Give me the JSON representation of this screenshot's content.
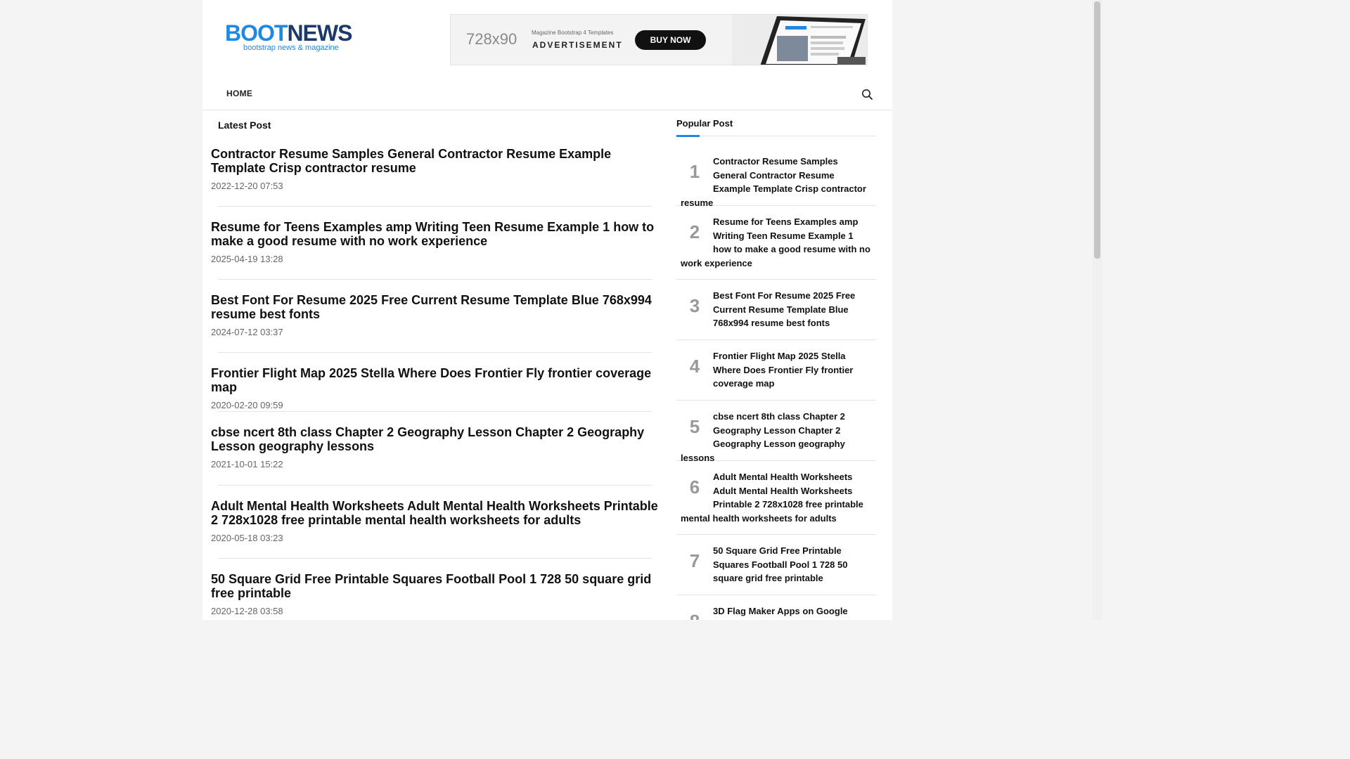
{
  "logo": {
    "word_a": "BOOT",
    "word_b": "NEWS",
    "tagline": "bootstrap news & magazine"
  },
  "ad": {
    "size_text": "728x90",
    "line1": "Magazine Bootstrap 4 Templates",
    "line2": "ADVERTISEMENT",
    "button": "BUY NOW"
  },
  "nav": {
    "home": "HOME",
    "search_icon": "search-icon"
  },
  "latest": {
    "title": "Latest Post",
    "posts": [
      {
        "title": "Contractor Resume Samples General Contractor Resume Example Template Crisp contractor resume",
        "date": "2022-12-20 07:53"
      },
      {
        "title": "Resume for Teens Examples amp Writing Teen Resume Example 1 how to make a good resume with no work experience",
        "date": "2025-04-19 13:28"
      },
      {
        "title": "Best Font For Resume 2025 Free Current Resume Template Blue 768x994 resume best fonts",
        "date": "2024-07-12 03:37"
      },
      {
        "title": "Frontier Flight Map 2025 Stella Where Does Frontier Fly frontier coverage map",
        "date": "2020-02-20 09:59"
      },
      {
        "title": "cbse ncert 8th class Chapter 2 Geography Lesson Chapter 2 Geography Lesson geography lessons",
        "date": "2021-10-01 15:22"
      },
      {
        "title": "Adult Mental Health Worksheets Adult Mental Health Worksheets Printable 2 728x1028 free printable mental health worksheets for adults",
        "date": "2020-05-18 03:23"
      },
      {
        "title": "50 Square Grid Free Printable Squares Football Pool 1 728 50 square grid free printable",
        "date": "2020-12-28 03:58"
      }
    ]
  },
  "popular": {
    "title": "Popular Post",
    "items": [
      {
        "num": "1",
        "title": "Contractor Resume Samples General Contractor Resume Example Template Crisp contractor resume"
      },
      {
        "num": "2",
        "title": "Resume for Teens Examples amp Writing Teen Resume Example 1 how to make a good resume with no work experience"
      },
      {
        "num": "3",
        "title": "Best Font For Resume 2025 Free Current Resume Template Blue 768x994 resume best fonts"
      },
      {
        "num": "4",
        "title": "Frontier Flight Map 2025 Stella Where Does Frontier Fly frontier coverage map"
      },
      {
        "num": "5",
        "title": "cbse ncert 8th class Chapter 2 Geography Lesson Chapter 2 Geography Lesson geography lessons"
      },
      {
        "num": "6",
        "title": "Adult Mental Health Worksheets Adult Mental Health Worksheets Printable 2 728x1028 free printable mental health worksheets for adults"
      },
      {
        "num": "7",
        "title": "50 Square Grid Free Printable Squares Football Pool 1 728 50 square grid free printable"
      },
      {
        "num": "8",
        "title": "3D Flag Maker Apps on Google"
      }
    ]
  },
  "colors": {
    "accent": "#1e88e5",
    "logo_dark": "#1a3a6b",
    "page_bg": "#f4f4f4"
  }
}
